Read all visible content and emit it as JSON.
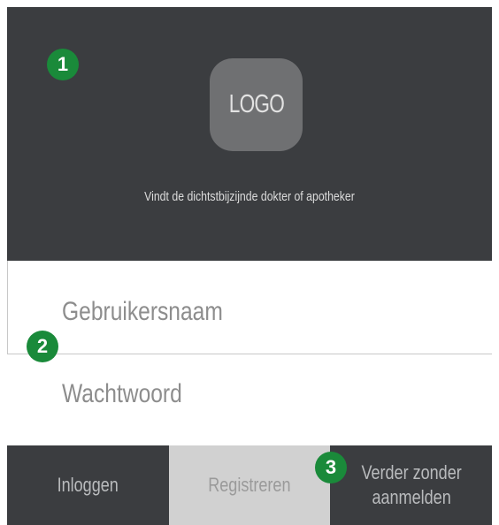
{
  "header": {
    "logo_label": "LOGO",
    "tagline": "Vindt de dichtstbijzijnde dokter of apotheker",
    "background": "#3b3d40"
  },
  "badges": [
    "1",
    "2",
    "3"
  ],
  "form": {
    "username_placeholder": "Gebruikersnaam",
    "password_placeholder": "Wachtwoord"
  },
  "footer": {
    "login_label": "Inloggen",
    "register_label": "Registreren",
    "guest_label_line1": "Verder zonder",
    "guest_label_line2": "aanmelden"
  },
  "colors": {
    "badge": "#1a8a3a",
    "dark": "#3b3d40",
    "light_button": "#d1d1d1"
  }
}
